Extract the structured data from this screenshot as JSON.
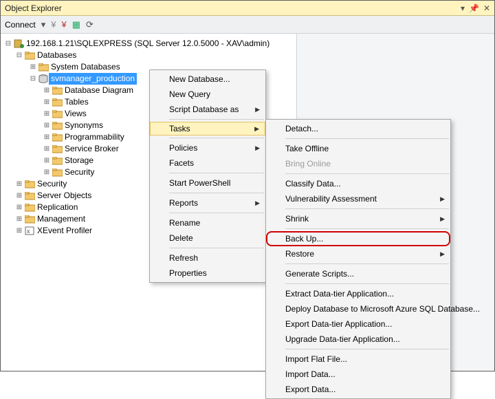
{
  "titlebar": {
    "title": "Object Explorer"
  },
  "toolbar": {
    "connect": "Connect"
  },
  "tree": {
    "server_label": "192.168.1.21\\SQLEXPRESS (SQL Server 12.0.5000 - XAV\\admin)",
    "databases": "Databases",
    "system_databases": "System Databases",
    "selected_db": "svmanager_production",
    "db_children": {
      "diagrams": "Database Diagram",
      "tables": "Tables",
      "views": "Views",
      "synonyms": "Synonyms",
      "programmability": "Programmability",
      "service_broker": "Service Broker",
      "storage": "Storage",
      "security": "Security"
    },
    "roots": {
      "security": "Security",
      "server_objects": "Server Objects",
      "replication": "Replication",
      "management": "Management",
      "xevent": "XEvent Profiler"
    }
  },
  "ctx1": {
    "new_database": "New Database...",
    "new_query": "New Query",
    "script_db_as": "Script Database as",
    "tasks": "Tasks",
    "policies": "Policies",
    "facets": "Facets",
    "start_powershell": "Start PowerShell",
    "reports": "Reports",
    "rename": "Rename",
    "delete": "Delete",
    "refresh": "Refresh",
    "properties": "Properties"
  },
  "ctx2": {
    "detach": "Detach...",
    "take_offline": "Take Offline",
    "bring_online": "Bring Online",
    "classify_data": "Classify Data...",
    "vuln": "Vulnerability Assessment",
    "shrink": "Shrink",
    "back_up": "Back Up...",
    "restore": "Restore",
    "gen_scripts": "Generate Scripts...",
    "extract_dt": "Extract Data-tier Application...",
    "deploy_azure": "Deploy Database to Microsoft Azure SQL Database...",
    "export_dt": "Export Data-tier Application...",
    "upgrade_dt": "Upgrade Data-tier Application...",
    "import_flat": "Import Flat File...",
    "import_data": "Import Data...",
    "export_data": "Export Data..."
  }
}
